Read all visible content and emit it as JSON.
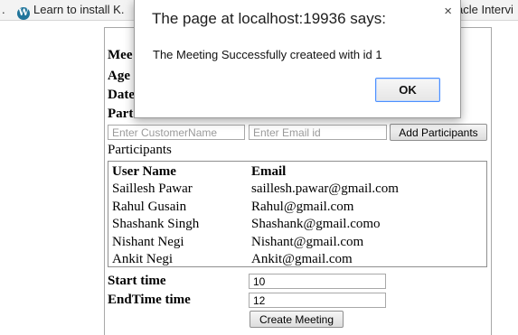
{
  "bookmarks": [
    {
      "label": "."
    },
    {
      "label": "Learn to install K."
    },
    {
      "label": "acle Intervi"
    }
  ],
  "form": {
    "labels_partial": [
      "Mee",
      "Age",
      "Date",
      "Part"
    ],
    "customer_placeholder": "Enter CustomerName",
    "email_placeholder": "Enter Email id",
    "add_participants_label": "Add Participants",
    "participants_heading": "Participants",
    "table": {
      "headers": [
        "User Name",
        "Email"
      ],
      "rows": [
        [
          "Saillesh Pawar",
          "saillesh.pawar@gmail.com"
        ],
        [
          "Rahul Gusain",
          "Rahul@gmail.com"
        ],
        [
          "Shashank Singh",
          "Shashank@gmail.como"
        ],
        [
          "Nishant Negi",
          "Nishant@gmail.com"
        ],
        [
          "Ankit Negi",
          "Ankit@gmail.com"
        ]
      ]
    },
    "start_label": "Start time",
    "start_value": "10",
    "end_label": "EndTime time",
    "end_value": "12",
    "create_label": "Create Meeting"
  },
  "dialog": {
    "title": "The page at localhost:19936 says:",
    "close_glyph": "×",
    "message": "The Meeting Successfully createed with id 1",
    "ok_label": "OK"
  }
}
